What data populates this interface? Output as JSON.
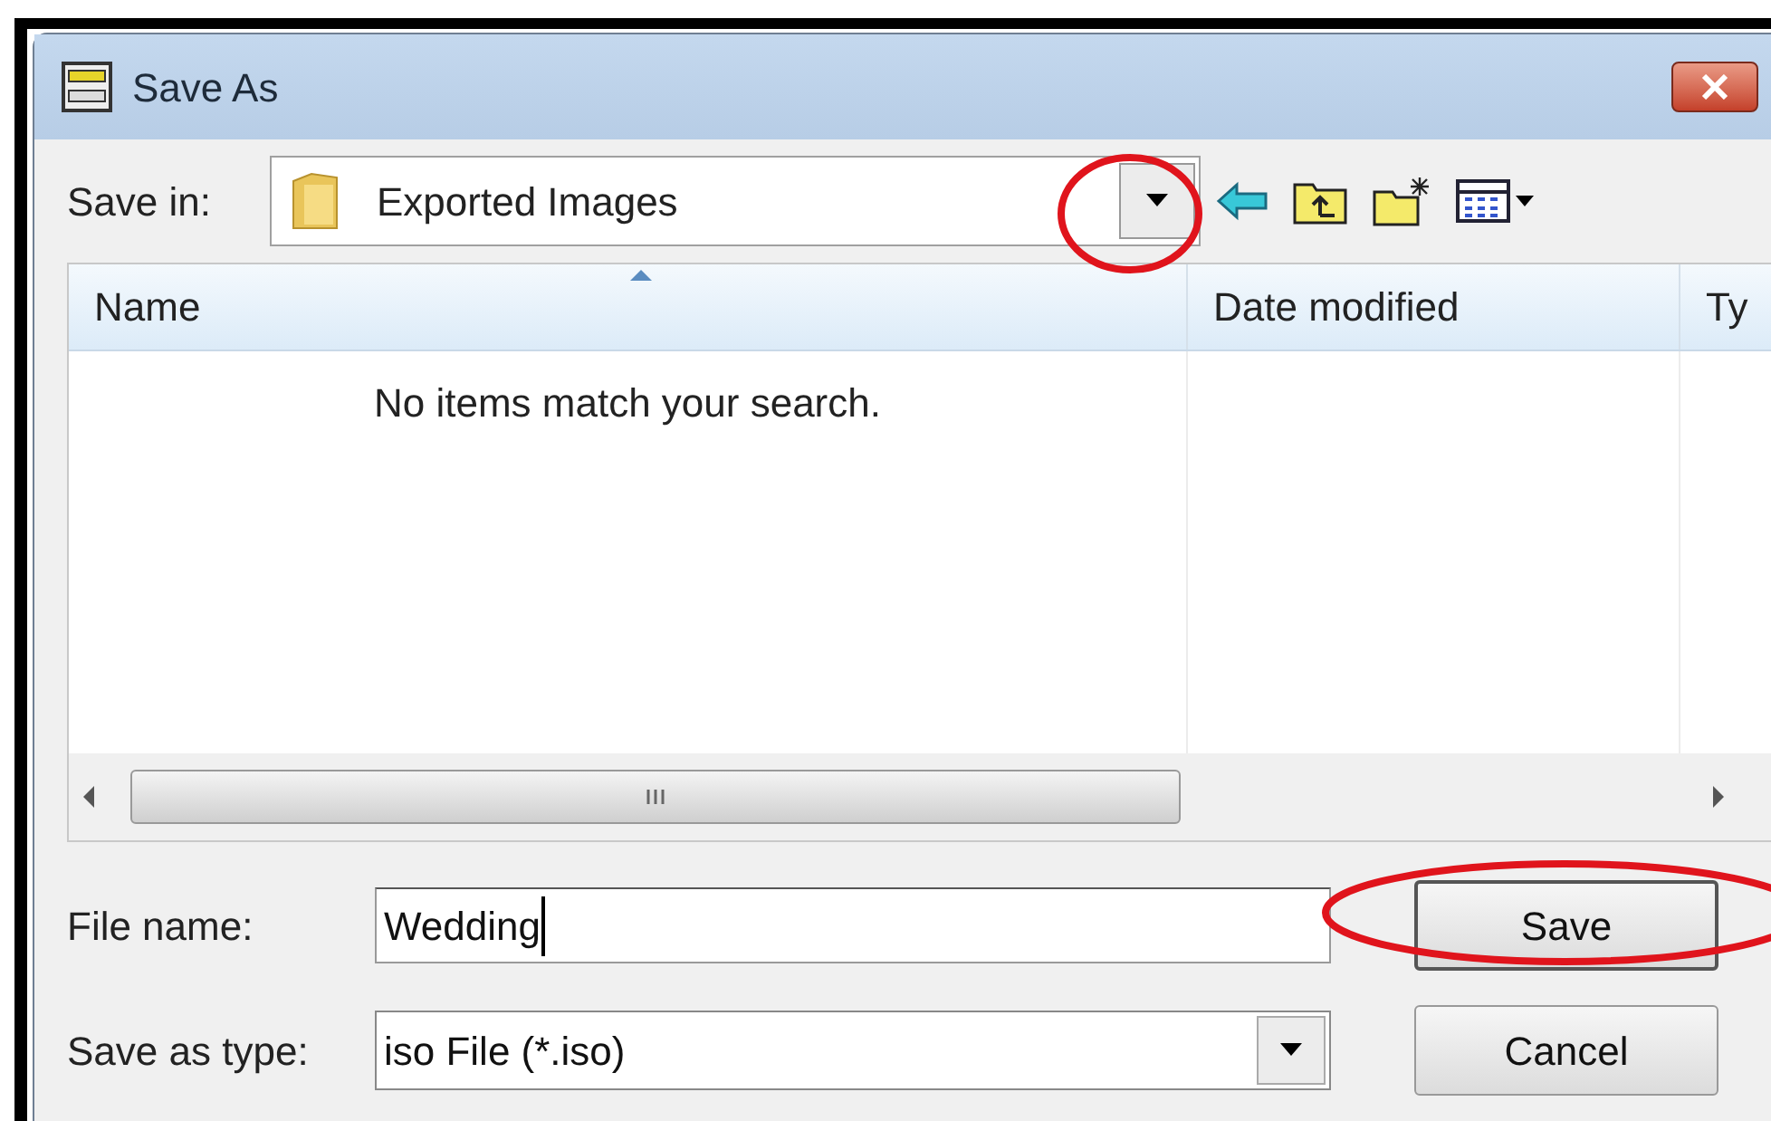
{
  "window": {
    "title": "Save As"
  },
  "save_in": {
    "label": "Save in:",
    "value": "Exported Images"
  },
  "file_list": {
    "columns": [
      {
        "label": "Name",
        "sorted": true
      },
      {
        "label": "Date modified",
        "sorted": false
      },
      {
        "label": "Ty",
        "sorted": false
      }
    ],
    "empty_message": "No items match your search."
  },
  "file_name": {
    "label": "File name:",
    "value": "Wedding"
  },
  "save_as_type": {
    "label": "Save as type:",
    "value": "iso File (*.iso)"
  },
  "buttons": [
    {
      "label": "Save",
      "kind": "default"
    },
    {
      "label": "Cancel",
      "kind": "normal"
    }
  ]
}
